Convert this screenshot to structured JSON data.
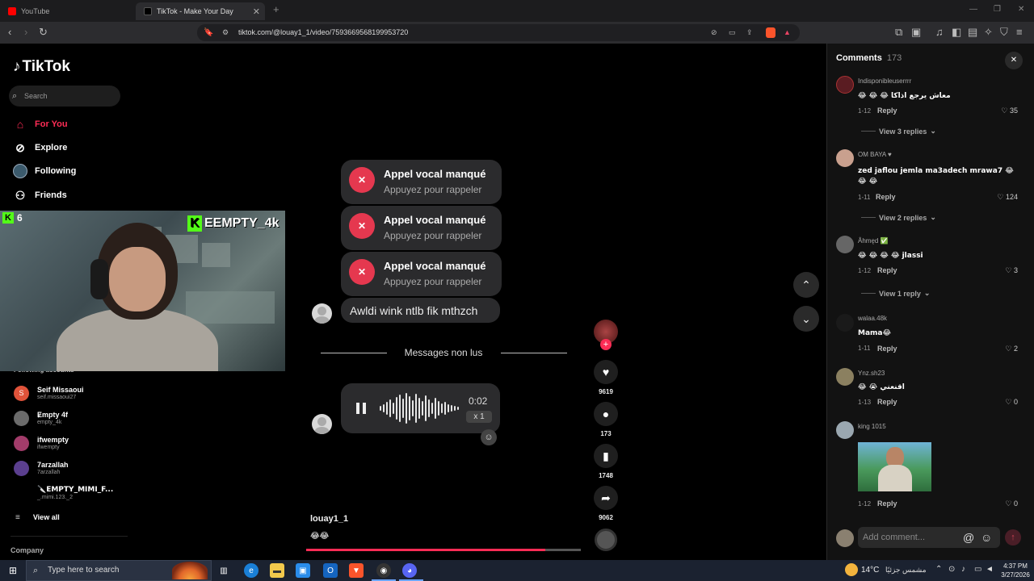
{
  "browser": {
    "tabs": [
      {
        "label": "YouTube",
        "active": false
      },
      {
        "label": "TikTok - Make Your Day",
        "active": true
      }
    ],
    "url": "tiktok.com/@louay1_1/video/7593669568199953720"
  },
  "sidebar": {
    "logo": "TikTok",
    "search_placeholder": "Search",
    "nav": [
      {
        "label": "For You",
        "icon": "home-icon",
        "active": true
      },
      {
        "label": "Explore",
        "icon": "compass-icon",
        "active": false
      },
      {
        "label": "Following",
        "icon": "following-icon",
        "active": false
      },
      {
        "label": "Friends",
        "icon": "friends-icon",
        "active": false
      }
    ],
    "following_label": "Following accounts",
    "accounts": [
      {
        "name": "Seif Missaoui",
        "username": "seif.missaoui27",
        "color": "#e0533a",
        "initial": "S"
      },
      {
        "name": "Ɇmpty 4f",
        "username": "empty_4k",
        "color": "#6b6b6b",
        "initial": ""
      },
      {
        "name": "ifwempty",
        "username": "ifwempty",
        "color": "#a23c6a",
        "initial": ""
      },
      {
        "name": "7arzallah",
        "username": "7arzallah",
        "color": "#5b3f8f",
        "initial": ""
      },
      {
        "name": "🔪EMPTY_MIMI_F...",
        "username": "_.mimi.123._2",
        "color": "#000000",
        "initial": ""
      }
    ],
    "view_all": "View all",
    "company": "Company"
  },
  "webcam": {
    "viewer_count": "6",
    "channel": "EEMPTY_4k"
  },
  "video": {
    "missed_calls": [
      {
        "title": "Appel vocal manqué",
        "subtitle": "Appuyez pour rappeler"
      },
      {
        "title": "Appel vocal manqué",
        "subtitle": "Appuyez pour rappeler"
      },
      {
        "title": "Appel vocal manqué",
        "subtitle": "Appuyez pour rappeler"
      }
    ],
    "message": "Awldi wink ntlb fik mthzch",
    "unread_divider": "Messages non lus",
    "voice_duration": "0:02",
    "voice_speed": "x 1",
    "author": "louay1_1",
    "caption": "😂😂",
    "progress": 0.87
  },
  "actions": {
    "likes": "9619",
    "comments": "173",
    "saves": "1748",
    "shares": "9062"
  },
  "comments": {
    "title": "Comments",
    "count": "173",
    "items": [
      {
        "user": "Indisponibleuserrrr",
        "text": "😂 😂 😂 معاش يرجع اذاكا",
        "date": "1-12",
        "reply": "Reply",
        "likes": "35",
        "view_replies": "View 3 replies",
        "avatar_color": "#5a1c22"
      },
      {
        "user": "OM BAYA ♥",
        "text": "zed jaflou jemla ma3adech mrawa7 😂 😂 😂",
        "date": "1-11",
        "reply": "Reply",
        "likes": "124",
        "view_replies": "View 2 replies",
        "avatar_color": "#c9a08e"
      },
      {
        "user": "Âhmęd ✅",
        "text": "😂 😂 😂 😂 jlassi",
        "date": "1-12",
        "reply": "Reply",
        "likes": "3",
        "view_replies": "View 1 reply",
        "avatar_color": "#666666"
      },
      {
        "user": "walaa.48k",
        "text": "Mama😂",
        "date": "1-11",
        "reply": "Reply",
        "likes": "2",
        "view_replies": "",
        "avatar_color": "#1a1a1a"
      },
      {
        "user": "Ynz.sh23",
        "text": "😂 😭 اقنعني",
        "date": "1-13",
        "reply": "Reply",
        "likes": "0",
        "view_replies": "",
        "avatar_color": "#8b8060"
      },
      {
        "user": "king 1015",
        "text": "",
        "date": "1-12",
        "reply": "Reply",
        "likes": "0",
        "view_replies": "",
        "avatar_color": "#9aa7b0"
      }
    ],
    "add_placeholder": "Add comment..."
  },
  "taskbar": {
    "search_placeholder": "Type here to search",
    "weather_temp": "14°C",
    "weather_desc": "مشمس جزئيًا",
    "time": "4:37 PM",
    "date": "3/27/2026"
  }
}
